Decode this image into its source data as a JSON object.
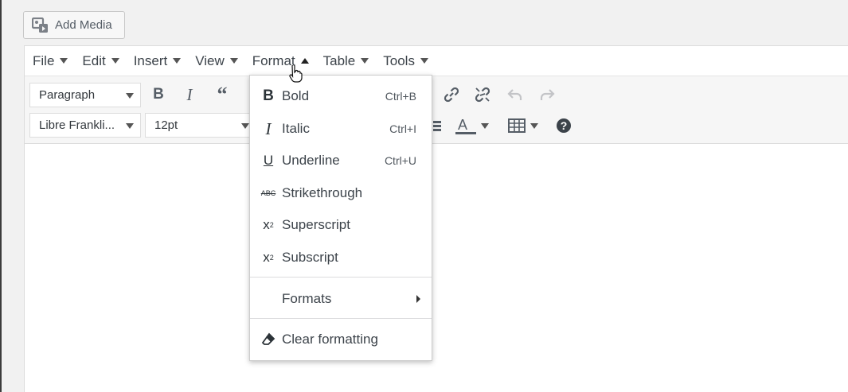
{
  "add_media": {
    "label": "Add Media",
    "icon": "media-icon"
  },
  "menubar": {
    "items": [
      {
        "label": "File",
        "open": false
      },
      {
        "label": "Edit",
        "open": false
      },
      {
        "label": "Insert",
        "open": false
      },
      {
        "label": "View",
        "open": false
      },
      {
        "label": "Format",
        "open": true
      },
      {
        "label": "Table",
        "open": false
      },
      {
        "label": "Tools",
        "open": false
      }
    ]
  },
  "toolbar": {
    "block_format": "Paragraph",
    "font_family": "Libre Frankli...",
    "font_size": "12pt",
    "buttons_row1": [
      "bold-icon",
      "italic-icon",
      "blockquote-icon",
      "link-icon",
      "unlink-icon",
      "undo-icon",
      "redo-icon"
    ],
    "buttons_row2": [
      "list-icon",
      "text-color-icon",
      "table-icon",
      "help-icon"
    ]
  },
  "format_menu": {
    "items": [
      {
        "label": "Bold",
        "shortcut": "Ctrl+B",
        "icon": "bold-icon"
      },
      {
        "label": "Italic",
        "shortcut": "Ctrl+I",
        "icon": "italic-icon"
      },
      {
        "label": "Underline",
        "shortcut": "Ctrl+U",
        "icon": "underline-icon"
      },
      {
        "label": "Strikethrough",
        "shortcut": "",
        "icon": "strikethrough-icon"
      },
      {
        "label": "Superscript",
        "shortcut": "",
        "icon": "superscript-icon"
      },
      {
        "label": "Subscript",
        "shortcut": "",
        "icon": "subscript-icon"
      }
    ],
    "formats_label": "Formats",
    "clear_label": "Clear formatting"
  },
  "colors": {
    "accent_text": "#3c434a",
    "toolbar_bg": "#f6f6f6",
    "page_bg": "#f1f1f1"
  }
}
